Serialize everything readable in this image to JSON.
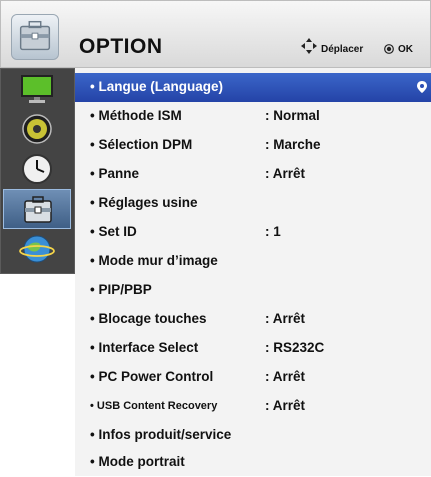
{
  "header": {
    "title": "OPTION",
    "move_label": "Déplacer",
    "ok_label": "OK"
  },
  "icons": {
    "header": "toolbox-icon",
    "sidebar": [
      "monitor-icon",
      "speaker-icon",
      "clock-icon",
      "toolbox-icon",
      "globe-icon"
    ],
    "hint_move": "directional-arrows-icon",
    "hint_ok": "ok-button-icon",
    "row_marker": "location-pin-icon"
  },
  "sidebar": {
    "active_index": 3
  },
  "menu": {
    "items": [
      {
        "label": "• Langue (Language)",
        "value": ""
      },
      {
        "label": "• Méthode ISM",
        "value": ": Normal"
      },
      {
        "label": "• Sélection DPM",
        "value": ": Marche"
      },
      {
        "label": "• Panne",
        "value": ": Arrêt"
      },
      {
        "label": "• Réglages usine",
        "value": ""
      },
      {
        "label": "• Set ID",
        "value": ": 1"
      },
      {
        "label": "• Mode mur d’image",
        "value": ""
      },
      {
        "label": "• PIP/PBP",
        "value": ""
      },
      {
        "label": "• Blocage touches",
        "value": ": Arrêt"
      },
      {
        "label": "• Interface Select",
        "value": ": RS232C"
      },
      {
        "label": "• PC Power Control",
        "value": ": Arrêt"
      },
      {
        "label": "• USB Content Recovery",
        "value": ": Arrêt"
      },
      {
        "label": "• Infos produit/service",
        "value": ""
      },
      {
        "label": "• Mode portrait",
        "value": ""
      }
    ],
    "selected_index": 0
  },
  "colors": {
    "selected_row": "#2d4fb5",
    "sidebar_bg": "#444444",
    "sidebar_active": "#4f6f97"
  }
}
